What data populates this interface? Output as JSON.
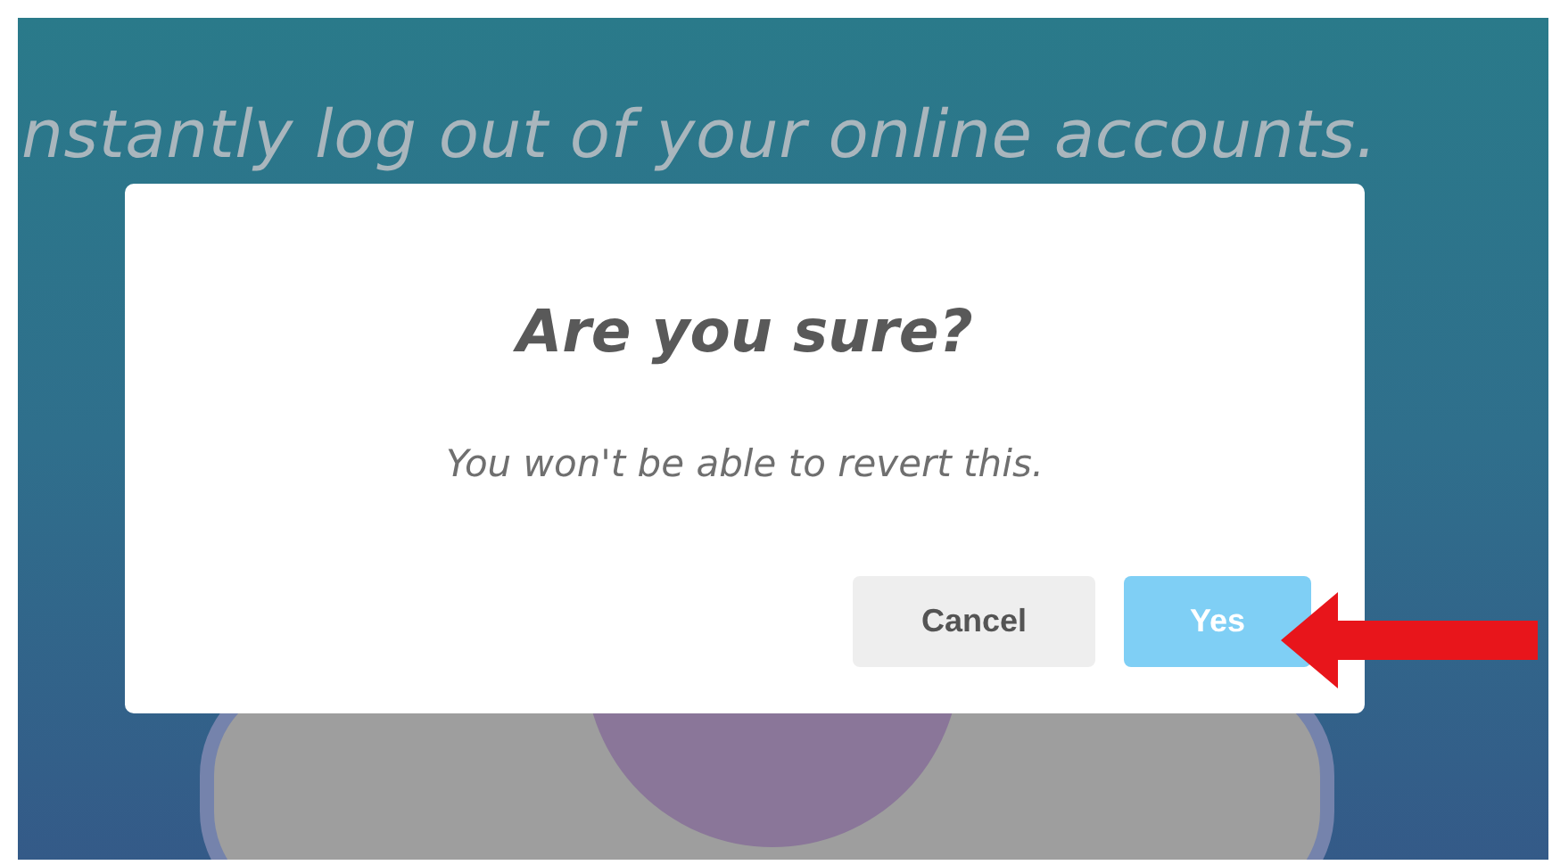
{
  "page": {
    "headline": "nstantly log out of your online accounts."
  },
  "dialog": {
    "title": "Are you sure?",
    "message": "You won't be able to revert this.",
    "buttons": [
      {
        "label": "Cancel",
        "kind": "cancel"
      },
      {
        "label": "Yes",
        "kind": "confirm"
      }
    ]
  }
}
